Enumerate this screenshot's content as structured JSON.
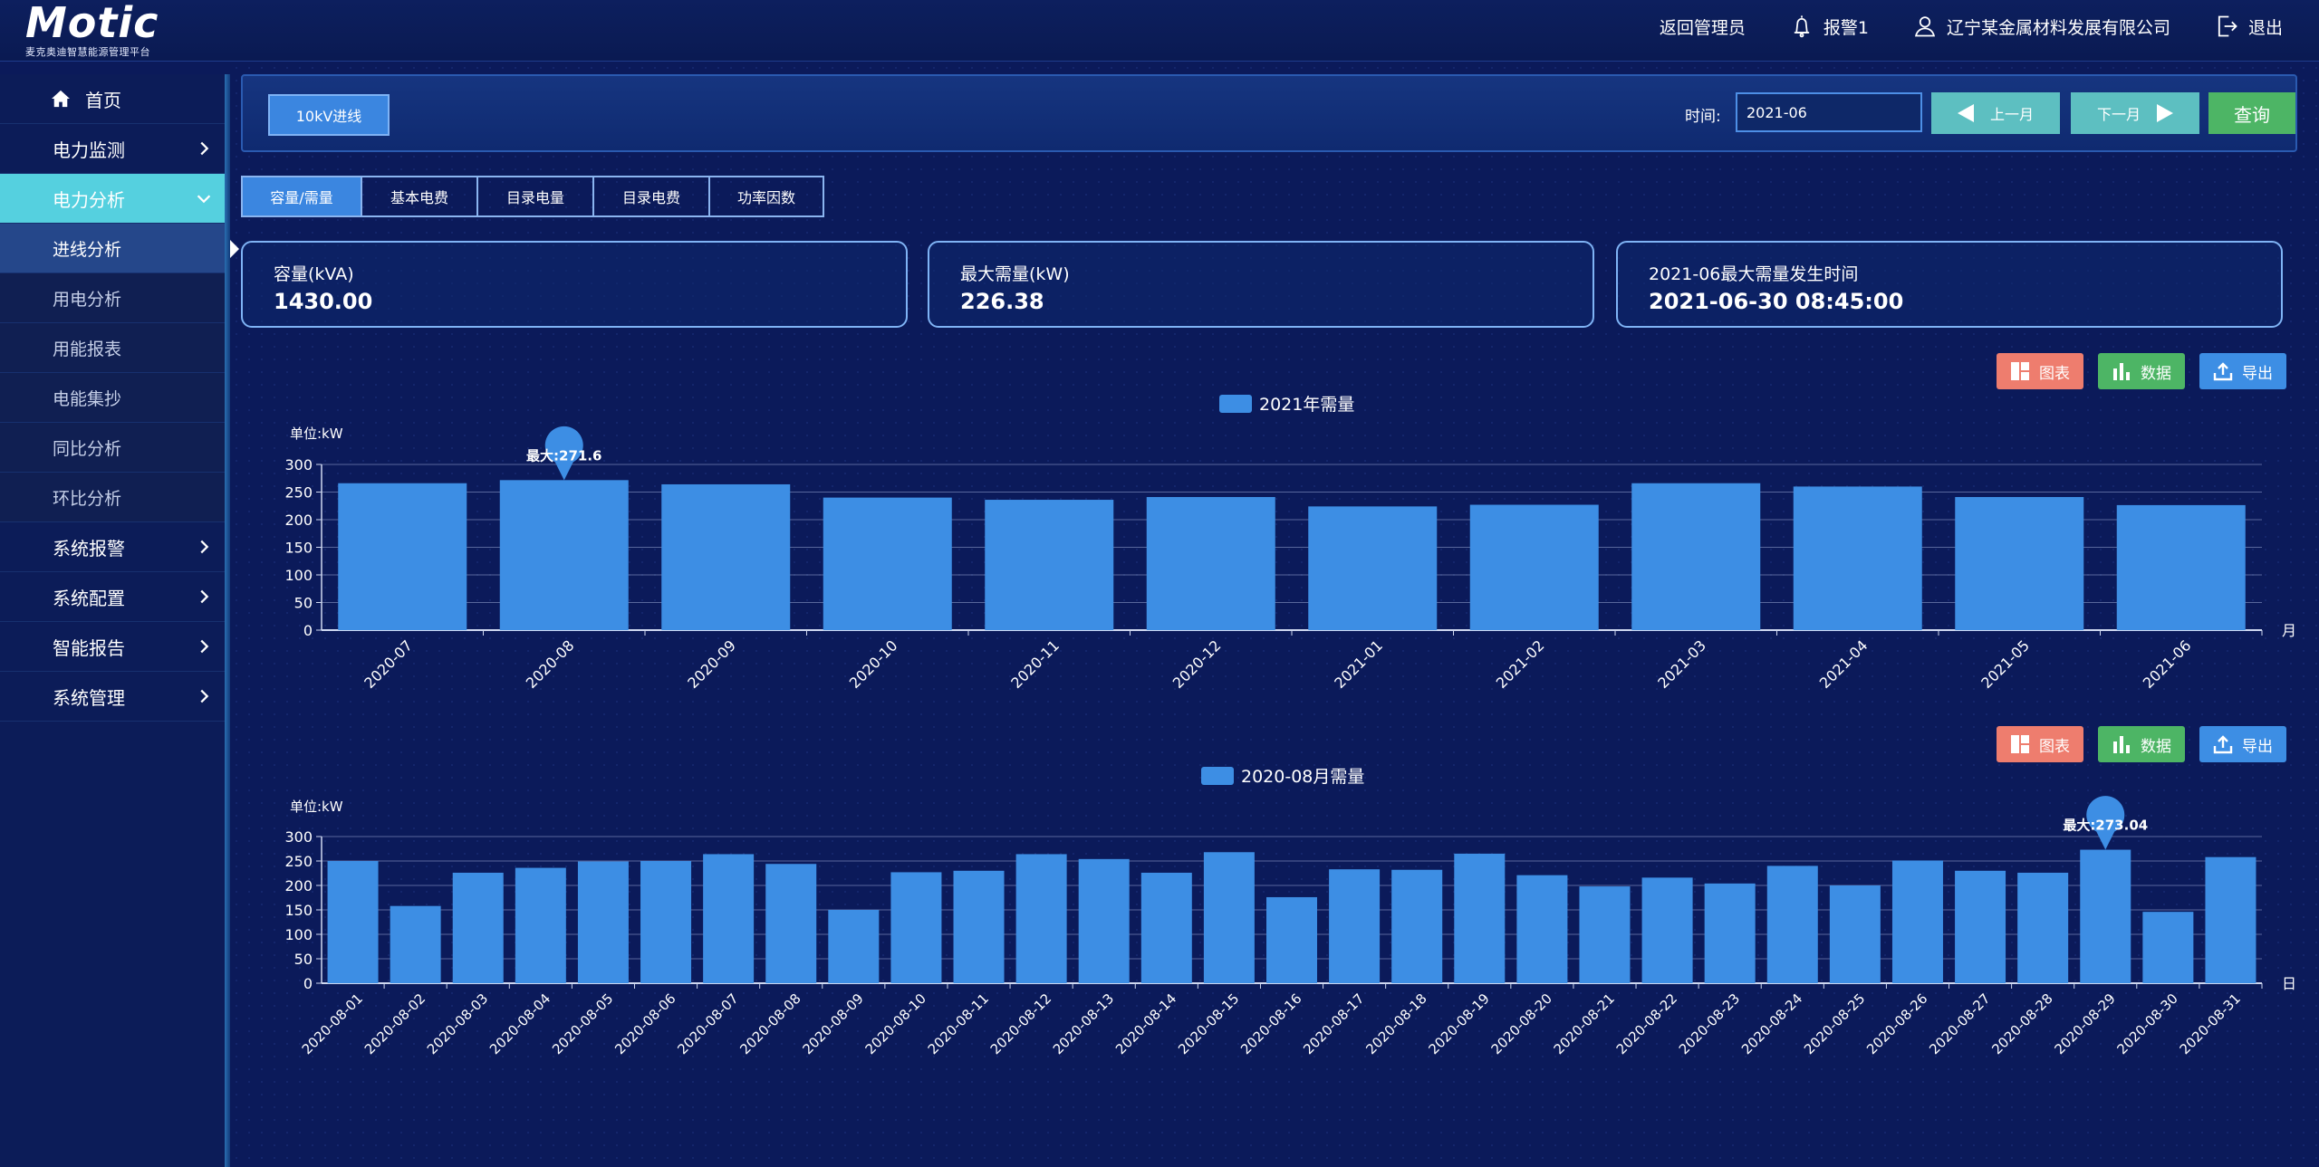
{
  "header": {
    "logo": "Motic",
    "logo_subtitle": "麦克奥迪智慧能源管理平台",
    "back_admin": "返回管理员",
    "alarm": "报警1",
    "company": "辽宁某金属材料发展有限公司",
    "logout": "退出"
  },
  "sidebar": {
    "items": [
      {
        "label": "首页"
      },
      {
        "label": "电力监测"
      },
      {
        "label": "电力分析"
      },
      {
        "label": "进线分析"
      },
      {
        "label": "用电分析"
      },
      {
        "label": "用能报表"
      },
      {
        "label": "电能集抄"
      },
      {
        "label": "同比分析"
      },
      {
        "label": "环比分析"
      },
      {
        "label": "系统报警"
      },
      {
        "label": "系统配置"
      },
      {
        "label": "智能报告"
      },
      {
        "label": "系统管理"
      }
    ]
  },
  "toolbar": {
    "line_button": "10kV进线",
    "time_label": "时间:",
    "time_value": "2021-06",
    "prev_label": "上一月",
    "next_label": "下一月",
    "query_label": "查询"
  },
  "tabs": [
    "容量/需量",
    "基本电费",
    "目录电量",
    "目录电费",
    "功率因数"
  ],
  "stats": [
    {
      "label": "容量(kVA)",
      "value": "1430.00"
    },
    {
      "label": "最大需量(kW)",
      "value": "226.38"
    },
    {
      "label": "2021-06最大需量发生时间",
      "value": "2021-06-30 08:45:00"
    }
  ],
  "chart_buttons": {
    "chart": "图表",
    "data": "数据",
    "export": "导出"
  },
  "colors": {
    "bar": "#3d8ee4",
    "accent": "#55d0df"
  },
  "chart_data": [
    {
      "type": "bar",
      "legend": "2021年需量",
      "ylabel": "单位:kW",
      "xunit": "月",
      "ylim": [
        0,
        300
      ],
      "yticks": [
        0,
        50,
        100,
        150,
        200,
        250,
        300
      ],
      "categories": [
        "2020-07",
        "2020-08",
        "2020-09",
        "2020-10",
        "2020-11",
        "2020-12",
        "2021-01",
        "2021-02",
        "2021-03",
        "2021-04",
        "2021-05",
        "2021-06"
      ],
      "values": [
        266,
        271.6,
        264,
        240,
        236,
        241,
        224,
        227,
        266,
        260,
        241,
        226.38
      ],
      "max_label": "最大:271.6",
      "max_index": 1
    },
    {
      "type": "bar",
      "legend": "2020-08月需量",
      "ylabel": "单位:kW",
      "xunit": "日",
      "ylim": [
        0,
        300
      ],
      "yticks": [
        0,
        50,
        100,
        150,
        200,
        250,
        300
      ],
      "categories": [
        "2020-08-01",
        "2020-08-02",
        "2020-08-03",
        "2020-08-04",
        "2020-08-05",
        "2020-08-06",
        "2020-08-07",
        "2020-08-08",
        "2020-08-09",
        "2020-08-10",
        "2020-08-11",
        "2020-08-12",
        "2020-08-13",
        "2020-08-14",
        "2020-08-15",
        "2020-08-16",
        "2020-08-17",
        "2020-08-18",
        "2020-08-19",
        "2020-08-20",
        "2020-08-21",
        "2020-08-22",
        "2020-08-23",
        "2020-08-24",
        "2020-08-25",
        "2020-08-26",
        "2020-08-27",
        "2020-08-28",
        "2020-08-29",
        "2020-08-30",
        "2020-08-31"
      ],
      "values": [
        250,
        158,
        226,
        236,
        249,
        250,
        264,
        244,
        150,
        227,
        230,
        264,
        254,
        226,
        268,
        176,
        233,
        232,
        265,
        221,
        198,
        216,
        204,
        240,
        200,
        251,
        230,
        226,
        273.04,
        146,
        258
      ],
      "max_label": "最大:273.04",
      "max_index": 28
    }
  ]
}
